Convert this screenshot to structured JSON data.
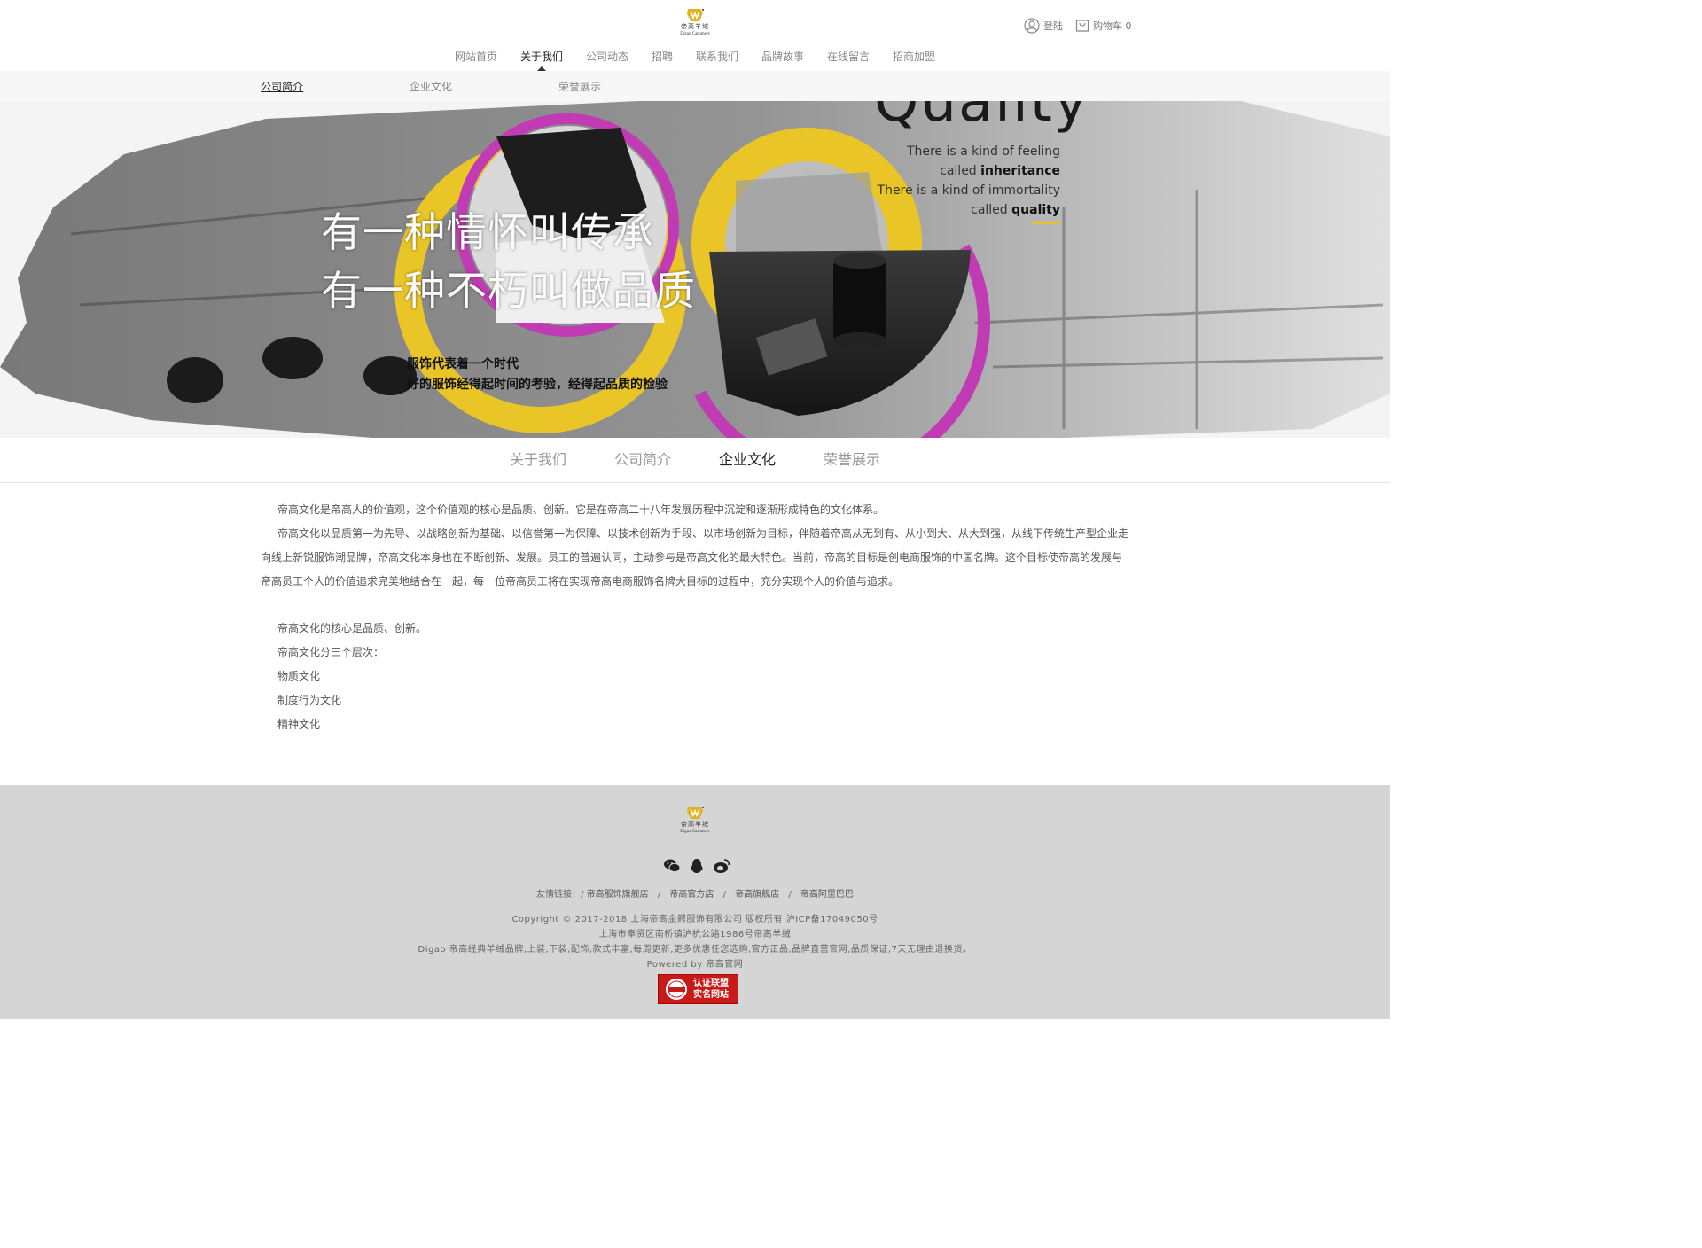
{
  "brand": {
    "name_cn": "帝高羊绒",
    "name_en": "Digao Cashmere",
    "color_gold": "#e6c42a"
  },
  "header": {
    "login": "登陆",
    "cart": "购物车 0",
    "nav": [
      "网站首页",
      "关于我们",
      "公司动态",
      "招聘",
      "联系我们",
      "品牌故事",
      "在线留言",
      "招商加盟"
    ]
  },
  "subnav": [
    "公司简介",
    "企业文化",
    "荣誉展示"
  ],
  "banner": {
    "title_1": "有一种情怀叫传承",
    "title_2": "有一种不朽叫做品质",
    "sub_1": "服饰代表着一个时代",
    "sub_2": "好的服饰经得起时间的考验，经得起品质的检验",
    "quality": "Quality",
    "q_line1": "There is a kind of feeling",
    "q_line2a": "called ",
    "q_line2b": "inheritance",
    "q_line3": "There is a kind of immortality",
    "q_line4a": "called ",
    "q_line4b": "quality",
    "colors": {
      "yellow": "#e9c527",
      "magenta": "#c03bb4"
    }
  },
  "tabs": [
    "关于我们",
    "公司简介",
    "企业文化",
    "荣誉展示"
  ],
  "content": {
    "p1": "帝高文化是帝高人的价值观，这个价值观的核心是品质、创新。它是在帝高二十八年发展历程中沉淀和逐渐形成特色的文化体系。",
    "p2": "帝高文化以品质第一为先导、以战略创新为基础、以信誉第一为保障、以技术创新为手段、以市场创新为目标，伴随着帝高从无到有、从小到大、从大到强，从线下传统生产型企业走向线上新锐服饰潮品牌，帝高文化本身也在不断创新、发展。员工的普遍认同，主动参与是帝高文化的最大特色。当前，帝高的目标是创电商服饰的中国名牌。这个目标使帝高的发展与帝高员工个人的价值追求完美地结合在一起，每一位帝高员工将在实现帝高电商服饰名牌大目标的过程中，充分实现个人的价值与追求。",
    "p3": "帝高文化的核心是品质、创新。",
    "p4": "帝高文化分三个层次：",
    "p5": "物质文化",
    "p6": "制度行为文化",
    "p7": "精神文化"
  },
  "footer": {
    "links_label": "友情链接：/",
    "links": [
      "帝高服饰旗舰店",
      "帝高官方店",
      "帝高旗舰店",
      "帝高阿里巴巴"
    ],
    "copyright": "Copyright © 2017-2018 上海帝高金鳄服饰有限公司 版权所有 沪ICP备17049050号",
    "address": "上海市奉贤区南桥镇沪杭公路1986号帝高羊绒",
    "desc": "Digao 帝高经典羊绒品牌,上装,下装,配饰,款式丰富,每周更新,更多优惠任您选购,官方正品,品牌直营官网,品质保证,7天无理由退换货。",
    "powered": "Powered by 帝高官网",
    "badge_1": "认证联盟",
    "badge_2": "实名网站",
    "footer_bg": "#d5d5d5"
  }
}
